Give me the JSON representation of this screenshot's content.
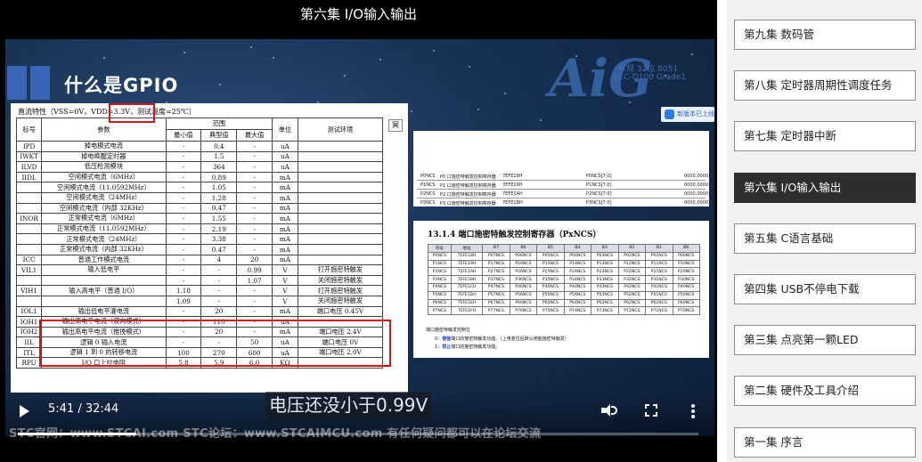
{
  "player": {
    "title": "第六集 I/O输入输出",
    "current_time": "5:41",
    "duration": "32:44",
    "progress": 0.1737,
    "subtitle": "电压还没小于0.99V",
    "watermark": "STC官网：www.STCAI.com      STC论坛：www.STCAIMCU.com      有任何疑问都可以在论坛交流"
  },
  "slide": {
    "heading": "什么是GPIO",
    "logo": "AiG",
    "logo_sub1": "车规 32位 8051",
    "logo_sub2": "AEC-Q100 Grade1",
    "share_label": "新版本已上线",
    "datasheet": {
      "caption": "直流特性（VSS=0V，VDD=3.3V，测试温度=25℃）",
      "side_button": "冥",
      "header": {
        "symbol": "标号",
        "param": "参数",
        "range": "范围",
        "min": "最小值",
        "typ": "典型值",
        "max": "最大值",
        "unit": "单位",
        "cond": "测试环境"
      },
      "rows": [
        {
          "sym": "IPD",
          "param": "掉电模式电流",
          "min": "-",
          "typ": "0.4",
          "max": "-",
          "unit": "uA",
          "cond": ""
        },
        {
          "sym": "IWKT",
          "param": "掉电唤醒定时器",
          "min": "-",
          "typ": "1.5",
          "max": "-",
          "unit": "uA",
          "cond": ""
        },
        {
          "sym": "ILVD",
          "param": "低压检测模块",
          "min": "-",
          "typ": "364",
          "max": "-",
          "unit": "uA",
          "cond": ""
        },
        {
          "sym": "IIDL",
          "param": "空闲模式电流（6MHz）",
          "min": "-",
          "typ": "0.89",
          "max": "-",
          "unit": "mA",
          "cond": ""
        },
        {
          "sym": "",
          "param": "空闲模式电流（11.0592MHz）",
          "min": "-",
          "typ": "1.05",
          "max": "-",
          "unit": "mA",
          "cond": ""
        },
        {
          "sym": "",
          "param": "空闲模式电流（24MHz）",
          "min": "-",
          "typ": "1.28",
          "max": "-",
          "unit": "mA",
          "cond": ""
        },
        {
          "sym": "",
          "param": "空闲模式电流（内部 32KHz）",
          "min": "-",
          "typ": "0.47",
          "max": "-",
          "unit": "mA",
          "cond": ""
        },
        {
          "sym": "INOR",
          "param": "正常模式电流（6MHz）",
          "min": "-",
          "typ": "1.55",
          "max": "-",
          "unit": "mA",
          "cond": ""
        },
        {
          "sym": "",
          "param": "正常模式电流（11.0592MHz）",
          "min": "-",
          "typ": "2.19",
          "max": "-",
          "unit": "mA",
          "cond": ""
        },
        {
          "sym": "",
          "param": "正常模式电流（24MHz）",
          "min": "-",
          "typ": "3.38",
          "max": "-",
          "unit": "mA",
          "cond": ""
        },
        {
          "sym": "",
          "param": "正常模式电流（内部 32KHz）",
          "min": "-",
          "typ": "0.47",
          "max": "-",
          "unit": "mA",
          "cond": ""
        },
        {
          "sym": "ICC",
          "param": "普通工作模式电流",
          "min": "-",
          "typ": "4",
          "max": "20",
          "unit": "mA",
          "cond": ""
        },
        {
          "sym": "VIL1",
          "param": "输入低电平",
          "min": "-",
          "typ": "-",
          "max": "0.99",
          "unit": "V",
          "cond": "打开施密特触发"
        },
        {
          "sym": "",
          "param": "",
          "min": "-",
          "typ": "-",
          "max": "1.07",
          "unit": "V",
          "cond": "关闭施密特触发"
        },
        {
          "sym": "VIH1",
          "param": "输入高电平（普通 I/O）",
          "min": "1.18",
          "typ": "-",
          "max": "-",
          "unit": "V",
          "cond": "打开施密特触发"
        },
        {
          "sym": "",
          "param": "",
          "min": "1.09",
          "typ": "-",
          "max": "-",
          "unit": "V",
          "cond": "关闭施密特触发"
        },
        {
          "sym": "IOL1",
          "param": "输出低电平灌电流",
          "min": "-",
          "typ": "20",
          "max": "-",
          "unit": "mA",
          "cond": "端口电压 0.45V"
        },
        {
          "sym": "IOH1",
          "param": "输出高电平电流（双向模式）",
          "min": "-",
          "typ": "110",
          "max": "-",
          "unit": "uA",
          "cond": ""
        },
        {
          "sym": "IOH2",
          "param": "输出高电平电流（推挽模式）",
          "min": "-",
          "typ": "20",
          "max": "-",
          "unit": "mA",
          "cond": "端口电压 2.4V"
        },
        {
          "sym": "IIL",
          "param": "逻辑 0 输入电流",
          "min": "-",
          "typ": "-",
          "max": "50",
          "unit": "uA",
          "cond": "端口电压 0V"
        },
        {
          "sym": "ITL",
          "param": "逻辑 1 到 0 的转移电流",
          "min": "100",
          "typ": "270",
          "max": "600",
          "unit": "uA",
          "cond": "端口电压 2.0V"
        },
        {
          "sym": "RPU",
          "param": "I/O 口上拉电阻",
          "min": "5.8",
          "typ": "5.9",
          "max": "6.0",
          "unit": "KΩ",
          "cond": ""
        }
      ]
    },
    "register_top_rows": [
      {
        "name": "P0NCS",
        "desc": "P0 口施密特触发控制寄存器",
        "addr": "7EFE18H",
        "bits": "P0NCS[7:0]",
        "reset": "0000,0000"
      },
      {
        "name": "P1NCS",
        "desc": "P1 口施密特触发控制寄存器",
        "addr": "7EFE19H",
        "bits": "P1NCS[7:0]",
        "reset": "0000,0000"
      },
      {
        "name": "P2NCS",
        "desc": "P2 口施密特触发控制寄存器",
        "addr": "7EFE1AH",
        "bits": "P2NCS[7:0]",
        "reset": "0000,0000"
      },
      {
        "name": "P3NCS",
        "desc": "P3 口施密特触发控制寄存器",
        "addr": "7EFE1BH",
        "bits": "P3NCS[7:0]",
        "reset": "0000,0000"
      },
      {
        "name": "P4NCS",
        "desc": "P4 口施密特触发控制寄存器",
        "addr": "7EFE1CH",
        "bits": "P4NCS[7:0]",
        "reset": "0000,0000"
      },
      {
        "name": "P5NCS",
        "desc": "P5 口施密特触发控制寄存器",
        "addr": "7EFE1DH",
        "bits": "P5NCS[7:0]",
        "reset": "0000,0000"
      },
      {
        "name": "P6NCS",
        "desc": "P6 口施密特触发控制寄存器",
        "addr": "7EFE1EH",
        "bits": "P6NCS[7:0]",
        "reset": "0000,0000"
      },
      {
        "name": "P7NCS",
        "desc": "P7 口施密特触发控制寄存器",
        "addr": "7EFE1FH",
        "bits": "P7NCS[7:0]",
        "reset": "0000,0000"
      }
    ],
    "register_section": {
      "title": "13.1.4    端口施密特触发控制寄存器（PxNCS）",
      "columns": [
        "符号",
        "地址",
        "B7",
        "B6",
        "B5",
        "B4",
        "B3",
        "B2",
        "B1",
        "B0"
      ],
      "rows": [
        [
          "P0NCS",
          "7EFE18H",
          "P07NCS",
          "P06NCS",
          "P05NCS",
          "P04NCS",
          "P03NCS",
          "P02NCS",
          "P01NCS",
          "P00NCS"
        ],
        [
          "P1NCS",
          "7EFE19H",
          "P17NCS",
          "P16NCS",
          "P15NCS",
          "P14NCS",
          "P13NCS",
          "P12NCS",
          "P11NCS",
          "P10NCS"
        ],
        [
          "P2NCS",
          "7EFE1AH",
          "P27NCS",
          "P26NCS",
          "P25NCS",
          "P24NCS",
          "P23NCS",
          "P22NCS",
          "P21NCS",
          "P20NCS"
        ],
        [
          "P3NCS",
          "7EFE1BH",
          "P37NCS",
          "P36NCS",
          "P35NCS",
          "P34NCS",
          "P33NCS",
          "P32NCS",
          "P31NCS",
          "P30NCS"
        ],
        [
          "P4NCS",
          "7EFE1CH",
          "P47NCS",
          "P46NCS",
          "P45NCS",
          "P44NCS",
          "P43NCS",
          "P42NCS",
          "P41NCS",
          "P40NCS"
        ],
        [
          "P5NCS",
          "7EFE1DH",
          "P57NCS",
          "P56NCS",
          "P55NCS",
          "P54NCS",
          "P53NCS",
          "P52NCS",
          "P51NCS",
          "P50NCS"
        ],
        [
          "P6NCS",
          "7EFE1EH",
          "P67NCS",
          "P66NCS",
          "P65NCS",
          "P64NCS",
          "P63NCS",
          "P62NCS",
          "P61NCS",
          "P60NCS"
        ],
        [
          "P7NCS",
          "7EFE1FH",
          "P77NCS",
          "P76NCS",
          "P75NCS",
          "P74NCS",
          "P73NCS",
          "P72NCS",
          "P71NCS",
          "P70NCS"
        ]
      ],
      "note_title": "端口施密特触发控制位",
      "note_0_prefix": "0：",
      "note_0_bold": "使能",
      "note_0_rest": "端口的施密特触发功能。（上电复位后默认使能施密特触发）",
      "note_1_prefix": "1：",
      "note_1_bold": "禁止",
      "note_1_rest": "端口的施密特触发功能。"
    }
  },
  "episodes": [
    {
      "label": "第九集 数码管",
      "active": false
    },
    {
      "label": "第八集 定时器周期性调度任务",
      "active": false
    },
    {
      "label": "第七集 定时器中断",
      "active": false
    },
    {
      "label": "第六集 I/O输入输出",
      "active": true
    },
    {
      "label": "第五集 C语言基础",
      "active": false
    },
    {
      "label": "第四集 USB不停电下载",
      "active": false
    },
    {
      "label": "第三集 点亮第一颗LED",
      "active": false
    },
    {
      "label": "第二集 硬件及工具介绍",
      "active": false
    },
    {
      "label": "第一集 序言",
      "active": false
    }
  ],
  "colors": {
    "highlight_box": "#d01818",
    "active_episode": "#2e2e2e",
    "slide_accent": "#3a64b8"
  },
  "icons": {
    "play": "play-icon",
    "volume": "volume-icon",
    "fullscreen": "fullscreen-icon",
    "more": "more-vertical-icon"
  }
}
